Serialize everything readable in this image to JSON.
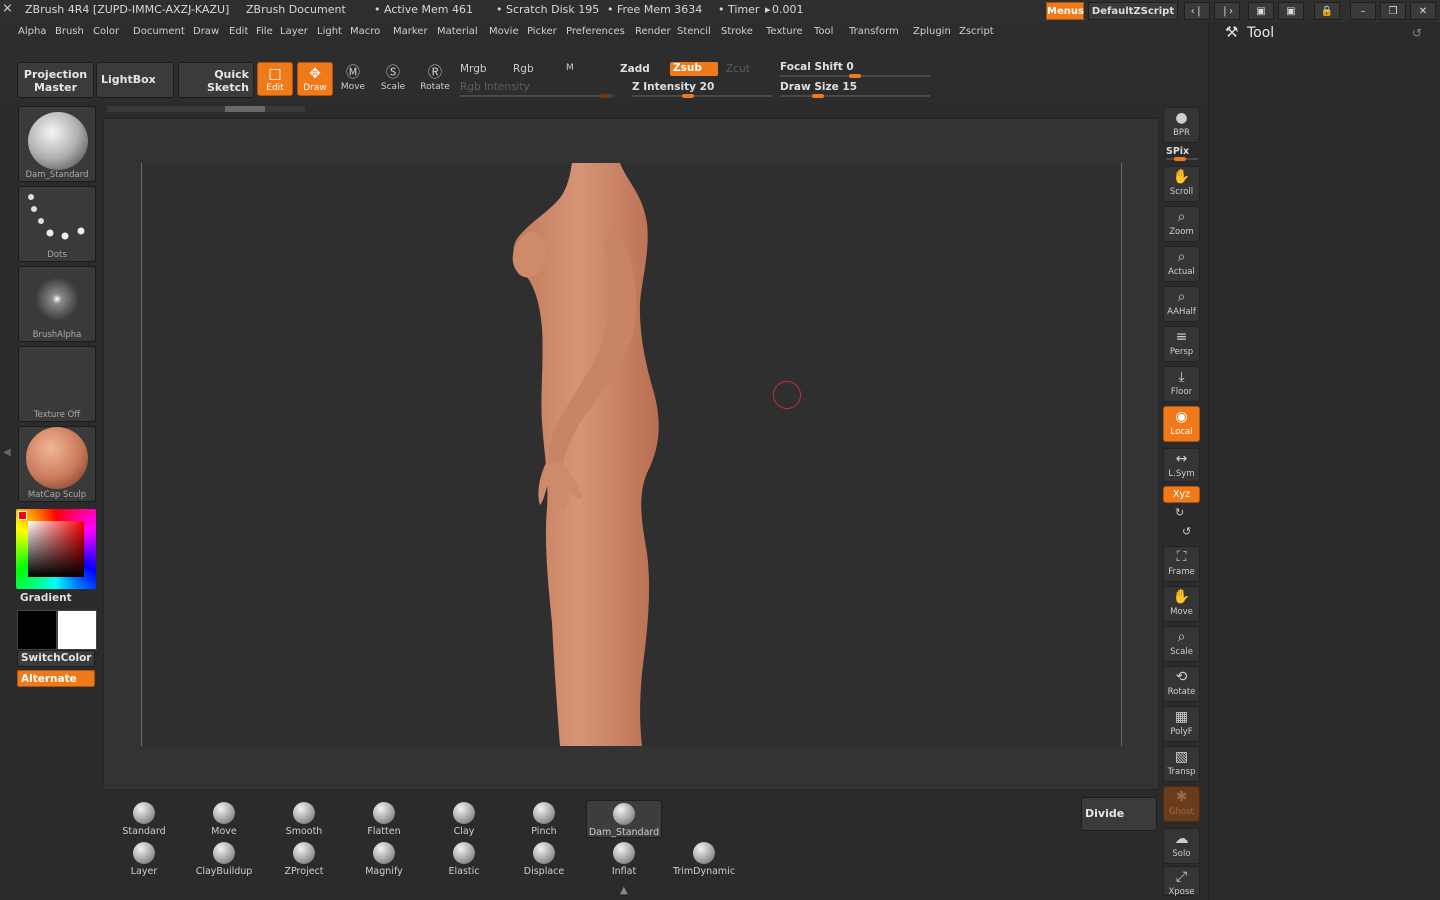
{
  "titlebar": {
    "app": "ZBrush 4R4 [ZUPD-IMMC-AXZJ-KAZU]",
    "doc": "ZBrush Document",
    "active_mem": "• Active Mem 461",
    "scratch": "• Scratch Disk 195",
    "free_mem": "• Free Mem 3634",
    "timer": "• Timer",
    "timer_value": "0.001",
    "menus_button": "Menus",
    "script_button": "DefaultZScript"
  },
  "menu": [
    "Alpha",
    "Brush",
    "Color",
    "Document",
    "Draw",
    "Edit",
    "File",
    "Layer",
    "Light",
    "Macro",
    "Marker",
    "Material",
    "Movie",
    "Picker",
    "Preferences",
    "Render",
    "Stencil",
    "Stroke",
    "Texture",
    "Tool",
    "Transform",
    "Zplugin",
    "Zscript"
  ],
  "toolbar": {
    "projection_master": [
      "Projection",
      "Master"
    ],
    "lightbox": "LightBox",
    "quick_sketch": [
      "Quick",
      "Sketch"
    ],
    "edit": "Edit",
    "draw": "Draw",
    "move": "Move",
    "scale": "Scale",
    "rotate": "Rotate",
    "mrgb": "Mrgb",
    "rgb": "Rgb",
    "m": "M",
    "rgb_intensity": "Rgb Intensity",
    "zadd": "Zadd",
    "zsub": "Zsub",
    "zcut": "Zcut",
    "z_intensity": "Z Intensity 20",
    "focal_shift": "Focal Shift 0",
    "draw_size": "Draw Size 15"
  },
  "left_shelf": {
    "brush": "Dam_Standard",
    "stroke": "Dots",
    "alpha": "BrushAlpha",
    "texture": "Texture Off",
    "material": "MatCap Sculp",
    "gradient": "Gradient",
    "switch_color": "SwitchColor",
    "alternate": "Alternate"
  },
  "right_shelf": [
    {
      "label": "BPR",
      "icon": "bpr-icon"
    },
    {
      "label": "SPix",
      "icon": "spix-icon"
    },
    {
      "label": "Scroll",
      "icon": "scroll-icon"
    },
    {
      "label": "Zoom",
      "icon": "zoom-icon"
    },
    {
      "label": "Actual",
      "icon": "actual-icon"
    },
    {
      "label": "AAHalf",
      "icon": "aahalf-icon"
    },
    {
      "label": "Persp",
      "icon": "persp-icon"
    },
    {
      "label": "Floor",
      "icon": "floor-icon"
    },
    {
      "label": "Local",
      "icon": "local-icon"
    },
    {
      "label": "L.Sym",
      "icon": "lsym-icon"
    },
    {
      "label": "Xyz",
      "icon": "xyz-icon"
    },
    {
      "label": "Frame",
      "icon": "frame-icon"
    },
    {
      "label": "Move",
      "icon": "move-icon"
    },
    {
      "label": "Scale",
      "icon": "scale-icon"
    },
    {
      "label": "Rotate",
      "icon": "rotate-icon"
    },
    {
      "label": "PolyF",
      "icon": "polyf-icon"
    },
    {
      "label": "Transp",
      "icon": "transp-icon"
    },
    {
      "label": "Ghost",
      "icon": "ghost-icon"
    },
    {
      "label": "Solo",
      "icon": "solo-icon"
    },
    {
      "label": "Xpose",
      "icon": "xpose-icon"
    }
  ],
  "tool_palette": {
    "title": "Tool"
  },
  "brush_shelf": {
    "row1": [
      "Standard",
      "Move",
      "Smooth",
      "Flatten",
      "Clay",
      "Pinch",
      "Dam_Standard"
    ],
    "row2": [
      "Layer",
      "ClayBuildup",
      "ZProject",
      "Magnify",
      "Elastic",
      "Displace",
      "Inflat",
      "TrimDynamic"
    ],
    "divide": "Divide"
  },
  "colors": {
    "accent": "#f07a1a",
    "skin": "#d08a6a",
    "bg": "#2b2b2b"
  }
}
